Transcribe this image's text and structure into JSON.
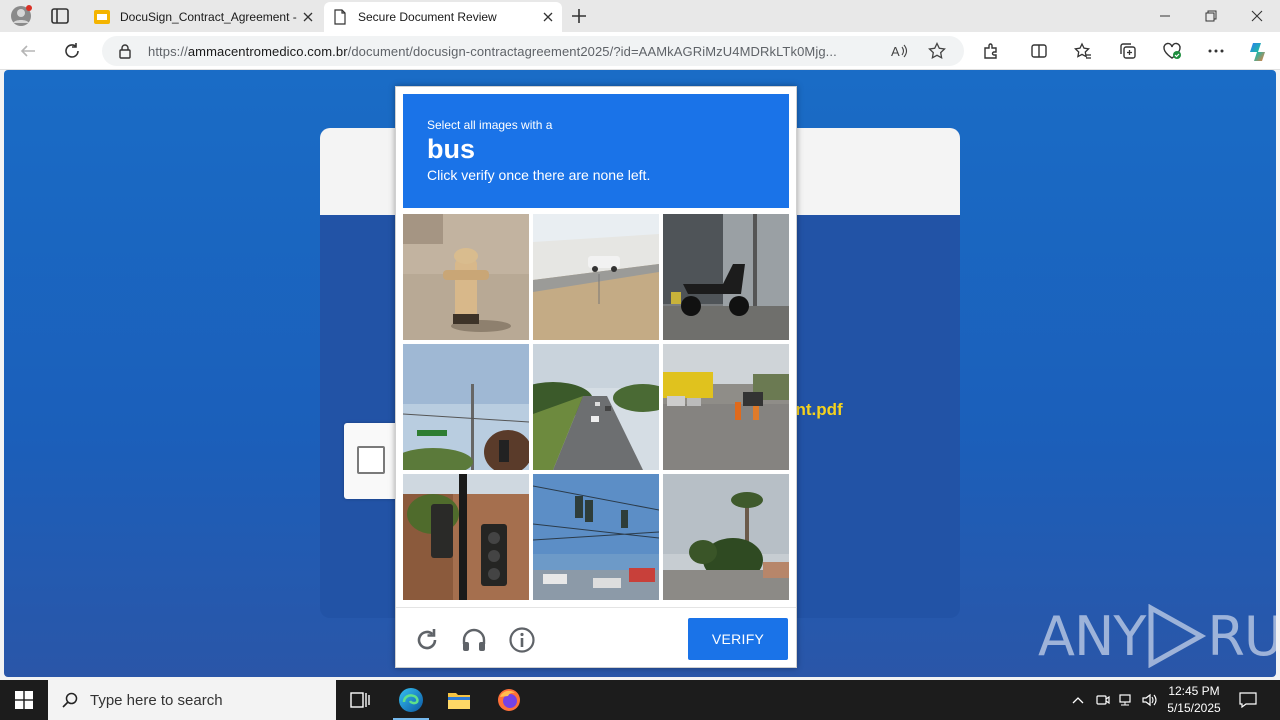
{
  "browser": {
    "tabs": [
      {
        "title": "DocuSign_Contract_Agreement -",
        "state": "inactive"
      },
      {
        "title": "Secure Document Review",
        "state": "active"
      }
    ],
    "url": {
      "prefix": "https://",
      "domain": "ammacentromedico.com.br",
      "path": "/document/docusign-contractagreement2025/?id=AAMkAGRiMzU4MDRkLTk0Mjg..."
    }
  },
  "page": {
    "filename_fragment": "ent.pdf",
    "colors": {
      "background": "#1b64c0",
      "card": "#2253a6",
      "filename": "#f5d21e"
    }
  },
  "captcha": {
    "prompt": "Select all images with a",
    "target": "bus",
    "instruction": "Click verify once there are none left.",
    "verify_label": "VERIFY",
    "tiles": [
      {
        "subject": "fire-hydrant"
      },
      {
        "subject": "car-on-road-snow"
      },
      {
        "subject": "scooter"
      },
      {
        "subject": "street-sign-sky"
      },
      {
        "subject": "highway"
      },
      {
        "subject": "street-construction"
      },
      {
        "subject": "traffic-light"
      },
      {
        "subject": "traffic-lights-sky"
      },
      {
        "subject": "palm-trees"
      }
    ],
    "accent": "#1a73e8"
  },
  "watermark": {
    "left": "ANY",
    "right": "RUN"
  },
  "taskbar": {
    "search_placeholder": "Type here to search",
    "time": "12:45 PM",
    "date": "5/15/2025"
  }
}
